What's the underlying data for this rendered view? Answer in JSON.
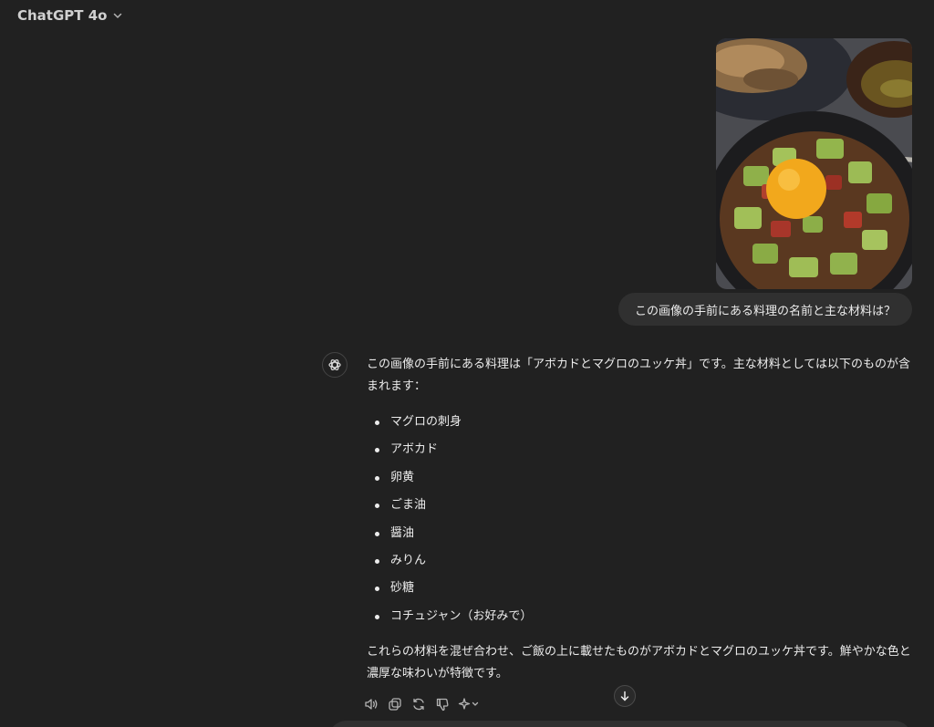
{
  "header": {
    "model_name": "ChatGPT 4o",
    "chevron_icon": "chevron-down-icon"
  },
  "conversation": {
    "user": {
      "image_icon": "food-photo-image",
      "message": "この画像の手前にある料理の名前と主な材料は？"
    },
    "assistant": {
      "avatar_icon": "openai-logo-icon",
      "intro": "この画像の手前にある料理は「アボカドとマグロのユッケ丼」です。主な材料としては以下のものが含まれます：",
      "ingredients": [
        "マグロの刺身",
        "アボカド",
        "卵黄",
        "ごま油",
        "醤油",
        "みりん",
        "砂糖",
        "コチュジャン（お好みで）"
      ],
      "outro": "これらの材料を混ぜ合わせ、ご飯の上に載せたものがアボカドとマグロのユッケ丼です。鮮やかな色と濃厚な味わいが特徴です。"
    }
  },
  "actions": {
    "read_aloud_icon": "speaker-icon",
    "copy_icon": "copy-icon",
    "regenerate_icon": "refresh-icon",
    "dislike_icon": "thumbs-down-icon",
    "change_model_icon": "sparkle-icon"
  },
  "scroll_icon": "arrow-down-icon",
  "colors": {
    "background": "#212121",
    "bubble": "#303030",
    "text": "#ececec",
    "muted": "#b4b4b4"
  }
}
